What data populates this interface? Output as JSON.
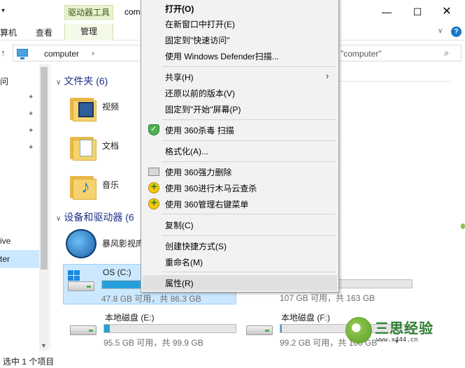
{
  "window": {
    "qa_arrow": "▾",
    "drive_tools_tab": "驱动器工具",
    "title": "computer",
    "controls": {
      "minimize": "—",
      "maximize": "☐",
      "close": "✕"
    }
  },
  "ribbon": {
    "tabs": [
      {
        "label": "算机"
      },
      {
        "label": "查看"
      },
      {
        "label": "管理"
      }
    ],
    "expand": "∨",
    "help": "?"
  },
  "address": {
    "up": "↑",
    "path": "computer",
    "chevron": "›",
    "search_text": "\"computer\"",
    "search_icon": "⌕"
  },
  "nav": {
    "quick_access": "问",
    "onedrive": "ive",
    "computer": "ter",
    "pin_glyph": "✦",
    "scroll_down": "▼"
  },
  "groups": {
    "folders": {
      "label": "文件夹 (6)",
      "chev": "∨"
    },
    "devices": {
      "label": "设备和驱动器 (6",
      "chev": "∨"
    }
  },
  "folders": [
    {
      "label": "视频"
    },
    {
      "label": "文档"
    },
    {
      "label": "音乐",
      "glyph": "♪"
    }
  ],
  "apps": [
    {
      "label": "暴风影视库"
    }
  ],
  "drives": {
    "c": {
      "label": "OS (C:)",
      "size": "47.8 GB 可用，共 86.3 GB",
      "used_fraction": 0.45
    },
    "d": {
      "label": "",
      "size": "107 GB 可用，共 163 GB",
      "used_fraction": 0.34
    },
    "e": {
      "label": "本地磁盘 (E:)",
      "size": "95.5 GB 可用，共 99.9 GB",
      "used_fraction": 0.04
    },
    "f": {
      "label": "本地磁盘 (F:)",
      "size": "99.2 GB 可用，共 100 GB",
      "used_fraction": 0.01
    }
  },
  "content": {
    "scroll_down": "▼"
  },
  "status": {
    "text": "选中 1 个项目"
  },
  "watermark": {
    "text": "三思经验",
    "sub": "www.x444.cn"
  },
  "context_menu": {
    "items": [
      {
        "label": "打开(O)"
      },
      {
        "label": "在新窗口中打开(E)"
      },
      {
        "label": "固定到\"快速访问\""
      },
      {
        "label": "使用 Windows Defender扫描..."
      },
      {
        "label": "共享(H)",
        "arrow": "›"
      },
      {
        "label": "还原以前的版本(V)"
      },
      {
        "label": "固定到\"开始\"屏幕(P)"
      },
      {
        "label": "使用 360杀毒 扫描"
      },
      {
        "label": "格式化(A)..."
      },
      {
        "label": "使用 360强力删除"
      },
      {
        "label": "使用 360进行木马云查杀"
      },
      {
        "label": "使用 360管理右键菜单"
      },
      {
        "label": "复制(C)"
      },
      {
        "label": "创建快捷方式(S)"
      },
      {
        "label": "重命名(M)"
      },
      {
        "label": "属性(R)"
      }
    ]
  },
  "colors": {
    "selection": "#cce8ff",
    "usage_fill": "#26a0da",
    "drive_tools_accent": "#e8f2d0",
    "menu_bg": "#f2f2f2"
  }
}
